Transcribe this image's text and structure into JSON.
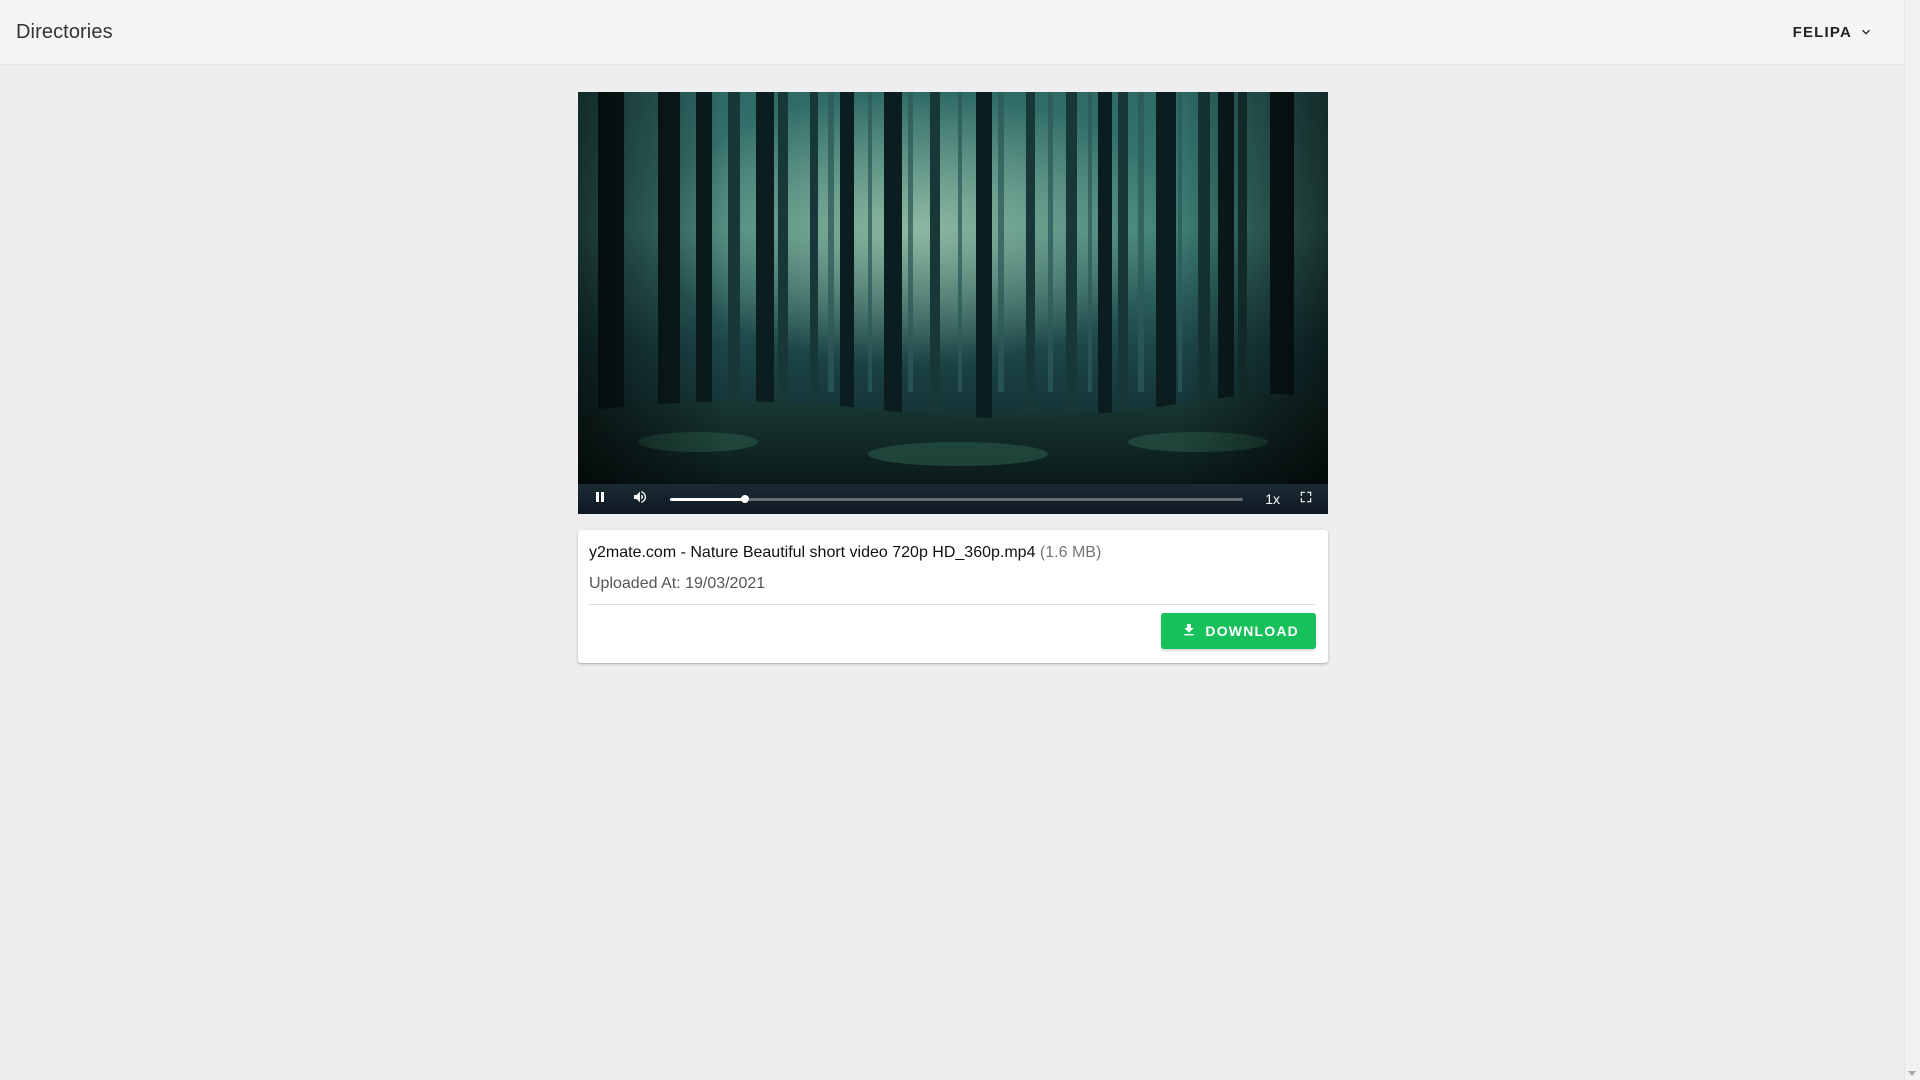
{
  "header": {
    "title": "Directories",
    "user_name": "FELIPA",
    "user_menu_icon": "chevron-down-icon"
  },
  "player": {
    "play_state_icon": "pause-icon",
    "volume_icon": "volume-icon",
    "progress_fraction": 0.13,
    "speed_label": "1x",
    "fullscreen_icon": "fullscreen-icon",
    "scene": "dark forest"
  },
  "file": {
    "name": "y2mate.com - Nature Beautiful short video 720p HD_360p.mp4",
    "size": "(1.6 MB)",
    "uploaded_at": "Uploaded At: 19/03/2021",
    "download_label": "DOWNLOAD",
    "download_icon": "download-icon"
  },
  "colors": {
    "accent_green": "#16c05a",
    "topbar_bg": "#f5f5f5",
    "page_bg": "#eeeeee"
  }
}
